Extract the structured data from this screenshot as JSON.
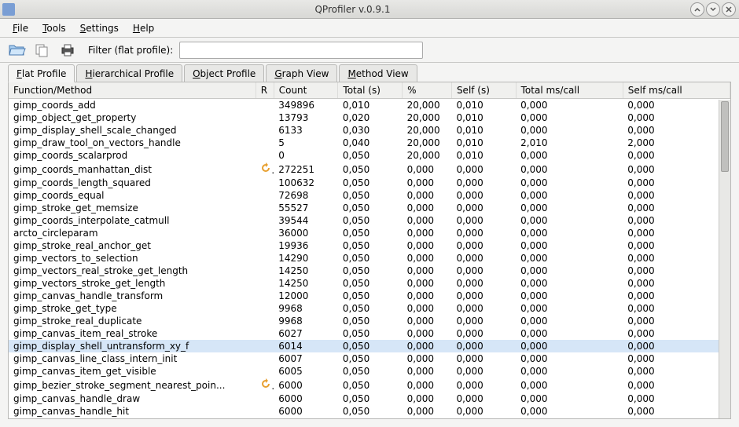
{
  "window": {
    "title": "QProfiler v.0.9.1"
  },
  "menu": {
    "file": "File",
    "tools": "Tools",
    "settings": "Settings",
    "help": "Help"
  },
  "toolbar": {
    "filter_label": "Filter (flat profile):",
    "filter_value": ""
  },
  "tabs": {
    "flat": "Flat Profile",
    "hier": "Hierarchical Profile",
    "obj": "Object Profile",
    "graph": "Graph View",
    "method": "Method View"
  },
  "columns": {
    "func": "Function/Method",
    "r": "R",
    "count": "Count",
    "total": "Total (s)",
    "pct": "%",
    "self": "Self (s)",
    "tmscall": "Total ms/call",
    "smscall": "Self ms/call"
  },
  "rows": [
    {
      "func": "gimp_coords_add",
      "r": "",
      "count": "349896",
      "total": "0,010",
      "pct": "20,000",
      "self": "0,010",
      "tmscall": "0,000",
      "smscall": "0,000"
    },
    {
      "func": "gimp_object_get_property",
      "r": "",
      "count": "13793",
      "total": "0,020",
      "pct": "20,000",
      "self": "0,010",
      "tmscall": "0,000",
      "smscall": "0,000"
    },
    {
      "func": "gimp_display_shell_scale_changed",
      "r": "",
      "count": "6133",
      "total": "0,030",
      "pct": "20,000",
      "self": "0,010",
      "tmscall": "0,000",
      "smscall": "0,000"
    },
    {
      "func": "gimp_draw_tool_on_vectors_handle",
      "r": "",
      "count": "5",
      "total": "0,040",
      "pct": "20,000",
      "self": "0,010",
      "tmscall": "2,010",
      "smscall": "2,000"
    },
    {
      "func": "gimp_coords_scalarprod",
      "r": "",
      "count": "0",
      "total": "0,050",
      "pct": "20,000",
      "self": "0,010",
      "tmscall": "0,000",
      "smscall": "0,000"
    },
    {
      "func": "gimp_coords_manhattan_dist",
      "r": "y",
      "count": "272251",
      "total": "0,050",
      "pct": "0,000",
      "self": "0,000",
      "tmscall": "0,000",
      "smscall": "0,000"
    },
    {
      "func": "gimp_coords_length_squared",
      "r": "",
      "count": "100632",
      "total": "0,050",
      "pct": "0,000",
      "self": "0,000",
      "tmscall": "0,000",
      "smscall": "0,000"
    },
    {
      "func": "gimp_coords_equal",
      "r": "",
      "count": "72698",
      "total": "0,050",
      "pct": "0,000",
      "self": "0,000",
      "tmscall": "0,000",
      "smscall": "0,000"
    },
    {
      "func": "gimp_stroke_get_memsize",
      "r": "",
      "count": "55527",
      "total": "0,050",
      "pct": "0,000",
      "self": "0,000",
      "tmscall": "0,000",
      "smscall": "0,000"
    },
    {
      "func": "gimp_coords_interpolate_catmull",
      "r": "",
      "count": "39544",
      "total": "0,050",
      "pct": "0,000",
      "self": "0,000",
      "tmscall": "0,000",
      "smscall": "0,000"
    },
    {
      "func": "arcto_circleparam",
      "r": "",
      "count": "36000",
      "total": "0,050",
      "pct": "0,000",
      "self": "0,000",
      "tmscall": "0,000",
      "smscall": "0,000"
    },
    {
      "func": "gimp_stroke_real_anchor_get",
      "r": "",
      "count": "19936",
      "total": "0,050",
      "pct": "0,000",
      "self": "0,000",
      "tmscall": "0,000",
      "smscall": "0,000"
    },
    {
      "func": "gimp_vectors_to_selection",
      "r": "",
      "count": "14290",
      "total": "0,050",
      "pct": "0,000",
      "self": "0,000",
      "tmscall": "0,000",
      "smscall": "0,000"
    },
    {
      "func": "gimp_vectors_real_stroke_get_length",
      "r": "",
      "count": "14250",
      "total": "0,050",
      "pct": "0,000",
      "self": "0,000",
      "tmscall": "0,000",
      "smscall": "0,000"
    },
    {
      "func": "gimp_vectors_stroke_get_length",
      "r": "",
      "count": "14250",
      "total": "0,050",
      "pct": "0,000",
      "self": "0,000",
      "tmscall": "0,000",
      "smscall": "0,000"
    },
    {
      "func": "gimp_canvas_handle_transform",
      "r": "",
      "count": "12000",
      "total": "0,050",
      "pct": "0,000",
      "self": "0,000",
      "tmscall": "0,000",
      "smscall": "0,000"
    },
    {
      "func": "gimp_stroke_get_type",
      "r": "",
      "count": "9968",
      "total": "0,050",
      "pct": "0,000",
      "self": "0,000",
      "tmscall": "0,000",
      "smscall": "0,000"
    },
    {
      "func": "gimp_stroke_real_duplicate",
      "r": "",
      "count": "9968",
      "total": "0,050",
      "pct": "0,000",
      "self": "0,000",
      "tmscall": "0,000",
      "smscall": "0,000"
    },
    {
      "func": "gimp_canvas_item_real_stroke",
      "r": "",
      "count": "6027",
      "total": "0,050",
      "pct": "0,000",
      "self": "0,000",
      "tmscall": "0,000",
      "smscall": "0,000"
    },
    {
      "func": "gimp_display_shell_untransform_xy_f",
      "r": "",
      "count": "6014",
      "total": "0,050",
      "pct": "0,000",
      "self": "0,000",
      "tmscall": "0,000",
      "smscall": "0,000",
      "selected": true
    },
    {
      "func": "gimp_canvas_line_class_intern_init",
      "r": "",
      "count": "6007",
      "total": "0,050",
      "pct": "0,000",
      "self": "0,000",
      "tmscall": "0,000",
      "smscall": "0,000"
    },
    {
      "func": "gimp_canvas_item_get_visible",
      "r": "",
      "count": "6005",
      "total": "0,050",
      "pct": "0,000",
      "self": "0,000",
      "tmscall": "0,000",
      "smscall": "0,000"
    },
    {
      "func": "gimp_bezier_stroke_segment_nearest_poin...",
      "r": "y",
      "count": "6000",
      "total": "0,050",
      "pct": "0,000",
      "self": "0,000",
      "tmscall": "0,000",
      "smscall": "0,000"
    },
    {
      "func": "gimp_canvas_handle_draw",
      "r": "",
      "count": "6000",
      "total": "0,050",
      "pct": "0,000",
      "self": "0,000",
      "tmscall": "0,000",
      "smscall": "0,000"
    },
    {
      "func": "gimp_canvas_handle_hit",
      "r": "",
      "count": "6000",
      "total": "0,050",
      "pct": "0,000",
      "self": "0,000",
      "tmscall": "0,000",
      "smscall": "0,000"
    }
  ]
}
